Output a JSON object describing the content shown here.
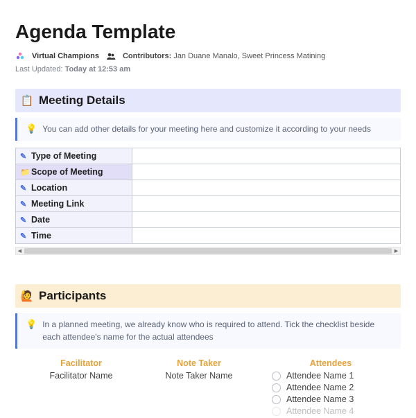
{
  "header": {
    "title": "Agenda Template",
    "workspace": "Virtual Champions",
    "contributors_label": "Contributors:",
    "contributors": "Jan Duane Manalo, Sweet Princess Matining",
    "last_updated_label": "Last Updated:",
    "last_updated_value": "Today at 12:53 am"
  },
  "meeting_details": {
    "heading": "Meeting Details",
    "callout": "You can add other details for your meeting here and customize it according to your needs",
    "rows": [
      {
        "label": "Type of Meeting",
        "value": ""
      },
      {
        "label": "Scope of Meeting",
        "value": ""
      },
      {
        "label": "Location",
        "value": ""
      },
      {
        "label": "Meeting Link",
        "value": ""
      },
      {
        "label": "Date",
        "value": ""
      },
      {
        "label": "Time",
        "value": ""
      }
    ]
  },
  "participants": {
    "heading": "Participants",
    "callout": "In a planned meeting, we already know who is required to attend. Tick the checklist beside each attendee's name for the actual attendees",
    "facilitator_heading": "Facilitator",
    "facilitator_name": "Facilitator Name",
    "note_taker_heading": "Note Taker",
    "note_taker_name": "Note Taker Name",
    "attendees_heading": "Attendees",
    "attendees": [
      "Attendee Name 1",
      "Attendee Name 2",
      "Attendee Name 3",
      "Attendee Name 4"
    ]
  }
}
